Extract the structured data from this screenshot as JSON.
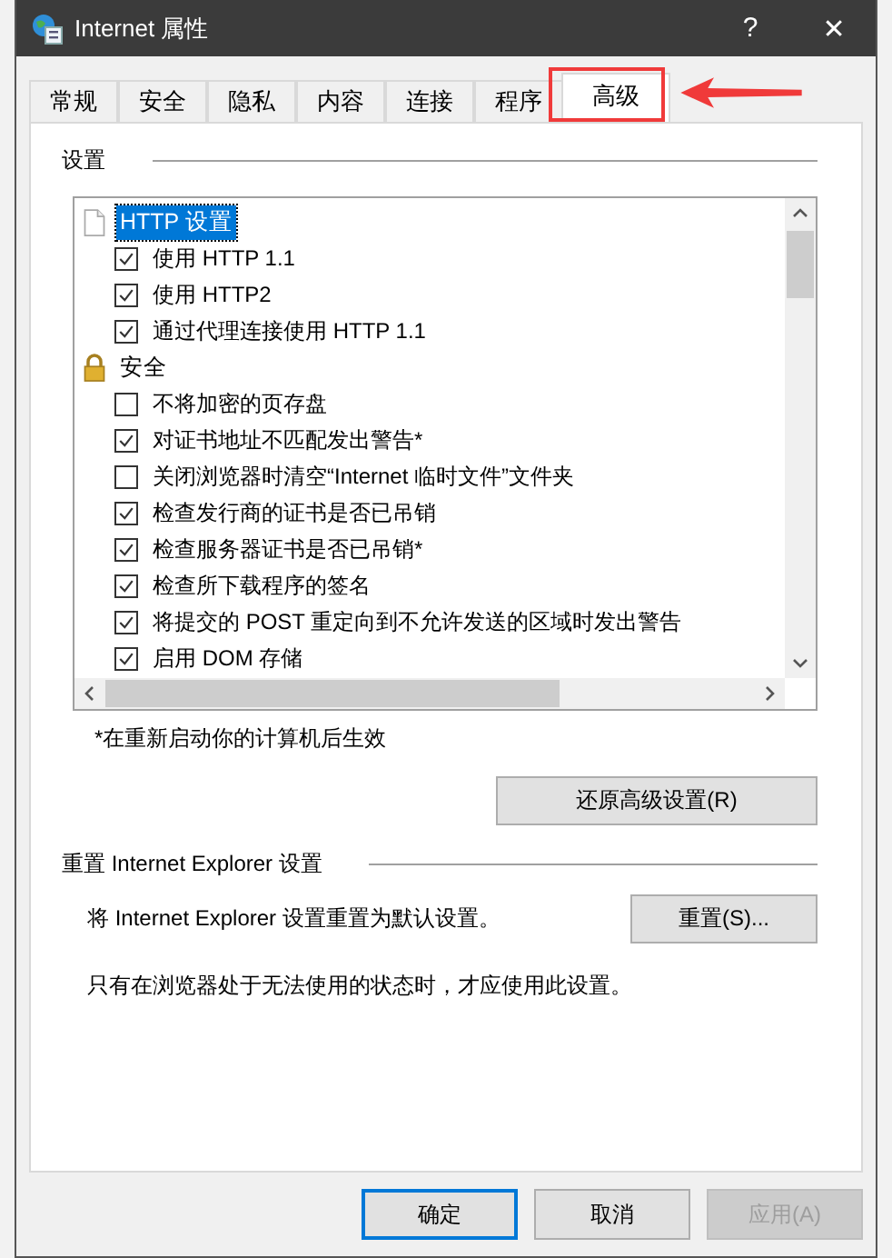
{
  "window": {
    "title": "Internet 属性",
    "help": "?",
    "close": "✕"
  },
  "tabs": [
    {
      "label": "常规",
      "selected": false
    },
    {
      "label": "安全",
      "selected": false
    },
    {
      "label": "隐私",
      "selected": false
    },
    {
      "label": "内容",
      "selected": false
    },
    {
      "label": "连接",
      "selected": false
    },
    {
      "label": "程序",
      "selected": false
    },
    {
      "label": "高级",
      "selected": true
    }
  ],
  "annotation": {
    "highlight_box": true,
    "arrow": true
  },
  "settings": {
    "heading": "设置",
    "tree": [
      {
        "label": "HTTP 设置",
        "kind": "page",
        "selected": true,
        "children": [
          {
            "label": "使用 HTTP 1.1",
            "checked": true
          },
          {
            "label": "使用 HTTP2",
            "checked": true
          },
          {
            "label": "通过代理连接使用 HTTP 1.1",
            "checked": true
          }
        ]
      },
      {
        "label": "安全",
        "kind": "lock",
        "selected": false,
        "children": [
          {
            "label": "不将加密的页存盘",
            "checked": false
          },
          {
            "label": "对证书地址不匹配发出警告*",
            "checked": true
          },
          {
            "label": "关闭浏览器时清空“Internet 临时文件”文件夹",
            "checked": false
          },
          {
            "label": "检查发行商的证书是否已吊销",
            "checked": true
          },
          {
            "label": "检查服务器证书是否已吊销*",
            "checked": true
          },
          {
            "label": "检查所下载程序的签名",
            "checked": true
          },
          {
            "label": "将提交的 POST 重定向到不允许发送的区域时发出警告",
            "checked": true
          },
          {
            "label": "启用 DOM 存储",
            "checked": true
          }
        ]
      }
    ],
    "note": "*在重新启动你的计算机后生效",
    "restore_button": "还原高级设置(R)"
  },
  "reset": {
    "heading": "重置 Internet Explorer 设置",
    "description": "将 Internet Explorer 设置重置为默认设置。",
    "button": "重置(S)...",
    "warning": "只有在浏览器处于无法使用的状态时，才应使用此设置。"
  },
  "buttons": [
    {
      "label": "确定",
      "kind": "default",
      "disabled": false
    },
    {
      "label": "取消",
      "kind": "normal",
      "disabled": false
    },
    {
      "label": "应用(A)",
      "kind": "normal",
      "disabled": true
    }
  ]
}
